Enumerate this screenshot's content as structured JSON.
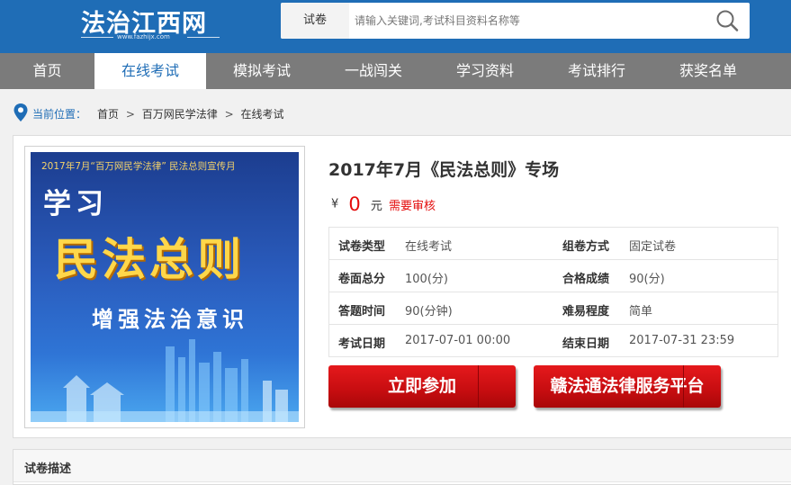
{
  "site": {
    "logo_title": "法治江西网",
    "logo_url": "www.fazhijx.com"
  },
  "search": {
    "type_label": "试卷",
    "placeholder": "请输入关键词,考试科目资料名称等",
    "button_icon": "search-icon"
  },
  "nav": {
    "items": [
      {
        "label": "首页"
      },
      {
        "label": "在线考试",
        "active": true
      },
      {
        "label": "模拟考试"
      },
      {
        "label": "一战闯关"
      },
      {
        "label": "学习资料"
      },
      {
        "label": "考试排行"
      },
      {
        "label": "获奖名单"
      }
    ]
  },
  "breadcrumb": {
    "label": "当前位置：",
    "items": [
      "首页",
      "百万网民学法律",
      "在线考试"
    ],
    "separator": ">"
  },
  "exam": {
    "title": "2017年7月《民法总则》专场",
    "price": {
      "currency": "¥",
      "value": "0",
      "unit": "元",
      "note": "需要审核"
    },
    "cover": {
      "top_text": "2017年7月“百万网民学法律”  民法总则宣传月",
      "line1": "学习",
      "line2": "民法总则",
      "line3": "增强法治意识"
    },
    "details": [
      {
        "left_label": "试卷类型",
        "left_value": "在线考试",
        "right_label": "组卷方式",
        "right_value": "固定试卷"
      },
      {
        "left_label": "卷面总分",
        "left_value": "100(分)",
        "right_label": "合格成绩",
        "right_value": "90(分)"
      },
      {
        "left_label": "答题时间",
        "left_value": "90(分钟)",
        "right_label": "难易程度",
        "right_value": "简单"
      },
      {
        "left_label": "考试日期",
        "left_value": "2017-07-01 00:00",
        "right_label": "结束日期",
        "right_value": "2017-07-31 23:59"
      }
    ],
    "buttons": {
      "join": "立即参加",
      "platform": "赣法通法律服务平台"
    }
  },
  "description": {
    "title": "试卷描述"
  },
  "colors": {
    "brand_blue": "#1f6db6",
    "nav_gray": "#7b7b7b",
    "price_red": "#e40c0c",
    "button_red": "#d11215"
  }
}
